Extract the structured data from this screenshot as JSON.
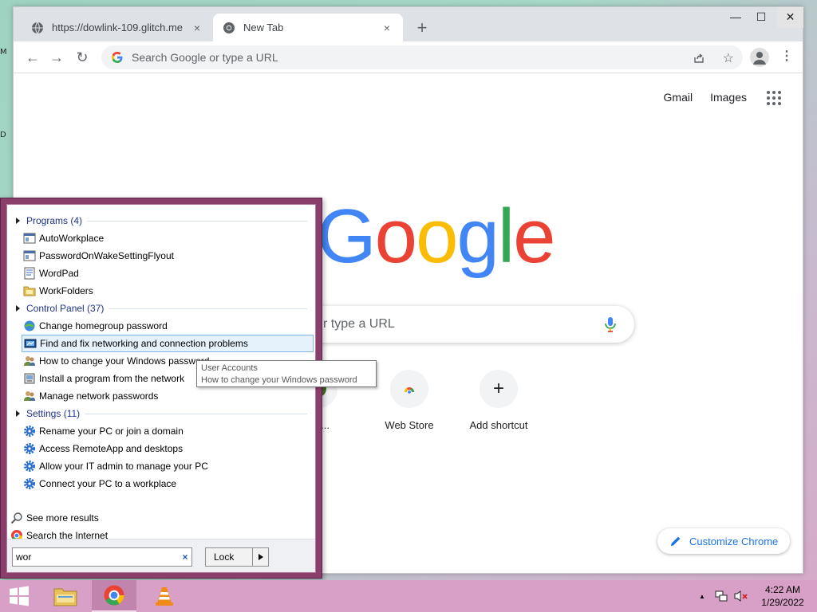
{
  "desktop": {
    "stub_top": "M",
    "stub_mid": "D"
  },
  "browser": {
    "tabs": [
      {
        "title": "https://dowlink-109.glitch.me",
        "close": "×"
      },
      {
        "title": "New Tab",
        "close": "×"
      }
    ],
    "new_tab": "+",
    "window": {
      "minimize": "—",
      "maximize": "☐",
      "close": "✕"
    },
    "nav": {
      "back": "←",
      "forward": "→",
      "reload": "↻"
    },
    "omnibox_placeholder": "Search Google or type a URL",
    "star": "☆",
    "menu": "⋮"
  },
  "ntp": {
    "links": [
      "Gmail",
      "Images"
    ],
    "logo": {
      "letters": [
        "G",
        "o",
        "o",
        "g",
        "l",
        "e"
      ],
      "colors": [
        "#4285F4",
        "#EA4335",
        "#FBBC05",
        "#4285F4",
        "#34A853",
        "#EA4335"
      ]
    },
    "search_text": "r type a URL",
    "shortcuts": [
      {
        "label": "dowli..."
      },
      {
        "label": "Web Store"
      },
      {
        "label": "Add shortcut",
        "glyph": "+"
      }
    ],
    "customize_label": "Customize Chrome"
  },
  "start_menu": {
    "sections": [
      {
        "label": "Programs (4)",
        "items": [
          "AutoWorkplace",
          "PasswordOnWakeSettingFlyout",
          "WordPad",
          "WorkFolders"
        ]
      },
      {
        "label": "Control Panel (37)",
        "items": [
          "Change homegroup password",
          "Find and fix networking and connection problems",
          "How to change your Windows password",
          "Install a program from the network",
          "Manage network passwords"
        ]
      },
      {
        "label": "Settings (11)",
        "items": [
          "Rename your PC or join a domain",
          "Access RemoteApp and desktops",
          "Allow your IT admin to manage your PC",
          "Connect your PC to a workplace"
        ]
      }
    ],
    "see_more": "See more results",
    "search_internet": "Search the Internet",
    "search_value": "wor",
    "clear": "×",
    "lock_label": "Lock",
    "tooltip": {
      "title": "User Accounts",
      "body": "How to change your Windows password"
    }
  },
  "taskbar": {
    "clock_time": "4:22 AM",
    "clock_date": "1/29/2022",
    "tray_up": "▲"
  },
  "colors": {
    "accent": "#1a73e8",
    "startmenu_border": "#8a3e6a",
    "taskbar": "#d8a0c6"
  }
}
